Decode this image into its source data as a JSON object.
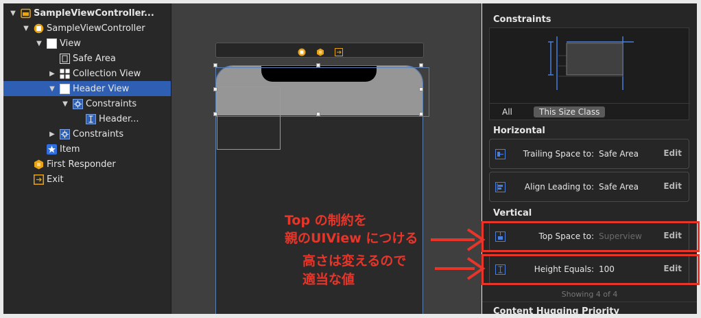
{
  "outline": {
    "items": [
      {
        "label": "SampleViewController...",
        "indent": 0,
        "expanded": true,
        "icon": "storyboard-scene-icon",
        "bold": true
      },
      {
        "label": "SampleViewController",
        "indent": 1,
        "expanded": true,
        "icon": "view-controller-icon"
      },
      {
        "label": "View",
        "indent": 2,
        "expanded": true,
        "icon": "view-icon"
      },
      {
        "label": "Safe Area",
        "indent": 3,
        "icon": "safe-area-icon"
      },
      {
        "label": "Collection View",
        "indent": 3,
        "expanded": false,
        "icon": "collection-view-icon"
      },
      {
        "label": "Header View",
        "indent": 3,
        "expanded": true,
        "icon": "view-icon",
        "selected": true
      },
      {
        "label": "Constraints",
        "indent": 4,
        "expanded": true,
        "icon": "constraints-icon"
      },
      {
        "label": "Header...",
        "indent": 5,
        "icon": "height-constraint-icon"
      },
      {
        "label": "Constraints",
        "indent": 3,
        "expanded": false,
        "icon": "constraints-icon"
      },
      {
        "label": "Item",
        "indent": 2,
        "icon": "tab-bar-item-icon"
      },
      {
        "label": "First Responder",
        "indent": 1,
        "icon": "first-responder-icon"
      },
      {
        "label": "Exit",
        "indent": 1,
        "icon": "exit-icon"
      }
    ]
  },
  "inspector": {
    "constraints_title": "Constraints",
    "tabs": {
      "all": "All",
      "size_class": "This Size Class"
    },
    "horizontal_title": "Horizontal",
    "vertical_title": "Vertical",
    "horizontal": [
      {
        "label": "Trailing Space to:",
        "value": "Safe Area",
        "edit": "Edit"
      },
      {
        "label": "Align Leading to:",
        "value": "Safe Area",
        "edit": "Edit"
      }
    ],
    "vertical": [
      {
        "label": "Top Space to:",
        "value": "Superview",
        "edit": "Edit"
      },
      {
        "label": "Height Equals:",
        "value": "100",
        "edit": "Edit"
      }
    ],
    "showing": "Showing 4 of 4",
    "next_section": "Content Hugging Priority"
  },
  "annotations": {
    "top_line1": "Top の制約を",
    "top_line2": "親のUIView につける",
    "height_line1": "高さは変えるので",
    "height_line2": "適当な値"
  },
  "colors": {
    "accent": "#2f5fb3",
    "annotation": "#e8352a"
  }
}
